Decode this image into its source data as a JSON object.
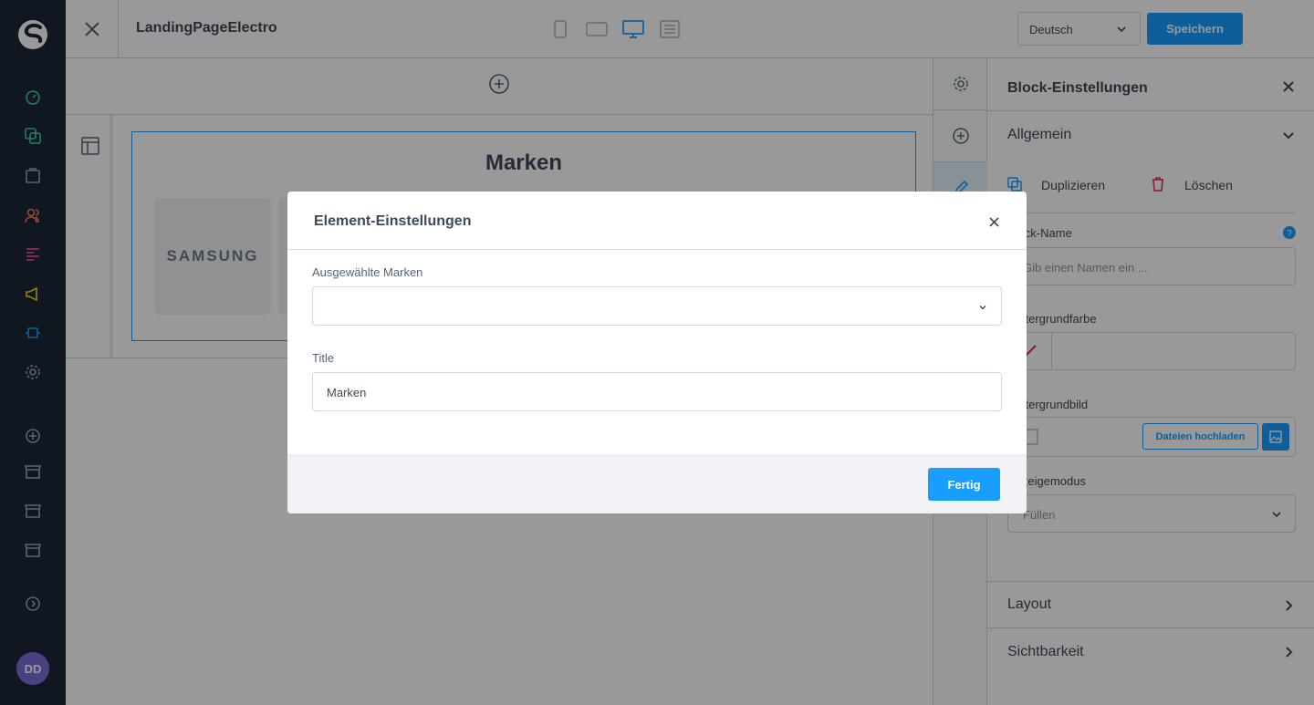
{
  "topbar": {
    "title": "LandingPageElectro",
    "language": "Deutsch",
    "save_label": "Speichern"
  },
  "canvas": {
    "block_title": "Marken",
    "brands": [
      "SAMSUNG",
      ""
    ]
  },
  "panel": {
    "title": "Block-Einstellungen",
    "general_section": "Allgemein",
    "duplicate_label": "Duplizieren",
    "delete_label": "Löschen",
    "block_name_label": "Block-Name",
    "block_name_placeholder": "Gib einen Namen ein ...",
    "bg_color_label": "Hintergrundfarbe",
    "bg_image_label": "Hintergrundbild",
    "upload_label": "Dateien hochladen",
    "mode_label": "Anzeigemodus",
    "mode_value": "Füllen",
    "layout_section": "Layout",
    "visibility_section": "Sichtbarkeit"
  },
  "user": {
    "initials": "DD"
  },
  "modal": {
    "title": "Element-Einstellungen",
    "brands_label": "Ausgewählte Marken",
    "brands_value": "",
    "title_label": "Title",
    "title_value": "Marken",
    "done_label": "Fertig"
  },
  "colors": {
    "accent": "#189eff",
    "nav_bg": "#1b2738",
    "delete_red": "#de294c"
  }
}
